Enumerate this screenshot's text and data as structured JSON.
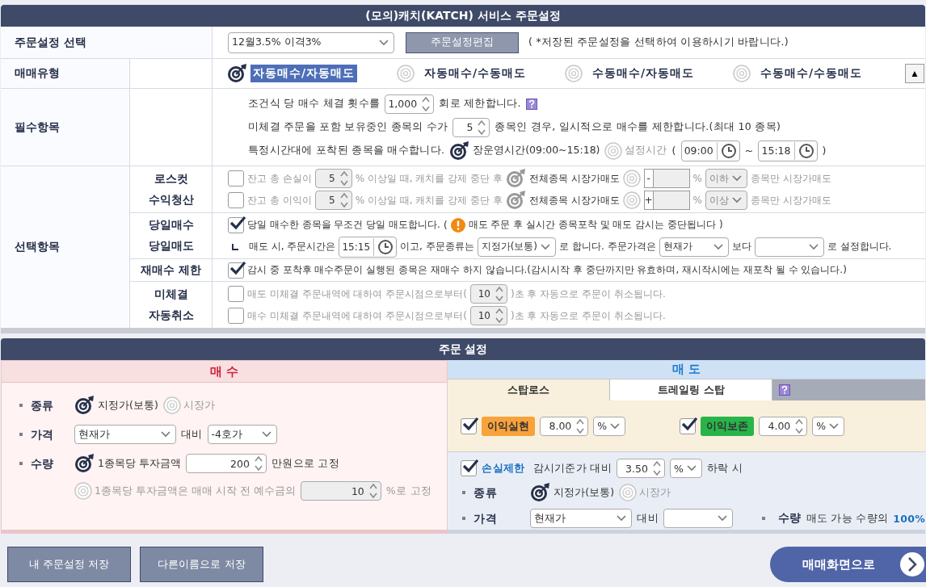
{
  "title": "(모의)캐치(KATCH) 서비스 주문설정",
  "settings_select": {
    "label": "주문설정 선택",
    "select": "12월3.5% 이격3%",
    "edit_button": "주문설정편집",
    "note": "( *저장된 주문설정을 선택하여 이용하시기 바랍니다.)"
  },
  "trade_type": {
    "label": "매매유형",
    "options": [
      {
        "label": "자동매수/자동매도",
        "selected": true
      },
      {
        "label": "자동매수/수동매도",
        "selected": false
      },
      {
        "label": "수동매수/자동매도",
        "selected": false
      },
      {
        "label": "수동매수/수동매도",
        "selected": false
      }
    ],
    "collapse_button": "▲"
  },
  "required": {
    "label": "필수항목",
    "lines": [
      {
        "items": [
          {
            "kind": "text",
            "text": "조건식 당 매수 체결 횟수를"
          },
          {
            "kind": "spin",
            "value": "1,000"
          },
          {
            "kind": "text",
            "text": "회로 제한합니다."
          },
          {
            "kind": "help"
          }
        ]
      },
      {
        "items": [
          {
            "kind": "text",
            "text": "미체결 주문을 포함 보유중인 종목의 수가"
          },
          {
            "kind": "spin",
            "value": "5"
          },
          {
            "kind": "text",
            "text": "종목인 경우, 일시적으로 매수를 제한합니다.(최대 10 종목)"
          }
        ]
      },
      {
        "items": [
          {
            "kind": "text",
            "text": "특정시간대에 포착된 종목을 매수합니다."
          },
          {
            "kind": "radio",
            "label": "장운영시간(09:00~15:18)",
            "selected": true
          },
          {
            "kind": "radio",
            "label": "설정시간",
            "selected": false
          },
          {
            "kind": "text",
            "text": "("
          },
          {
            "kind": "time",
            "value": "09:00"
          },
          {
            "kind": "text",
            "text": "~"
          },
          {
            "kind": "time",
            "value": "15:18"
          },
          {
            "kind": "text",
            "text": ")"
          }
        ]
      }
    ]
  },
  "optional": {
    "label": "선택항목",
    "groups": [
      {
        "labels": [
          "로스컷",
          "수익청산"
        ],
        "lines": [
          {
            "disabled": true,
            "items": [
              {
                "kind": "check",
                "checked": false
              },
              {
                "kind": "text",
                "text": "잔고 총 손실이"
              },
              {
                "kind": "spin",
                "value": "5"
              },
              {
                "kind": "text",
                "text": "% 이상일 때, 캐치를 강제 중단 후"
              },
              {
                "kind": "radio",
                "label": "전체종목 시장가매도",
                "selected": true
              },
              {
                "kind": "radio",
                "selected": false
              },
              {
                "kind": "signbox",
                "sign": "-"
              },
              {
                "kind": "text",
                "text": "%"
              },
              {
                "kind": "select",
                "value": "이하"
              },
              {
                "kind": "text",
                "text": "종목만 시장가매도"
              }
            ]
          },
          {
            "disabled": true,
            "items": [
              {
                "kind": "check",
                "checked": false
              },
              {
                "kind": "text",
                "text": "잔고 총 이익이"
              },
              {
                "kind": "spin",
                "value": "5"
              },
              {
                "kind": "text",
                "text": "% 이상일 때, 캐치를 강제 중단 후"
              },
              {
                "kind": "radio",
                "label": "전체종목 시장가매도",
                "selected": true
              },
              {
                "kind": "radio",
                "selected": false
              },
              {
                "kind": "signbox",
                "sign": "+"
              },
              {
                "kind": "text",
                "text": "%"
              },
              {
                "kind": "select",
                "value": "이상"
              },
              {
                "kind": "text",
                "text": "종목만 시장가매도"
              }
            ]
          }
        ]
      },
      {
        "labels": [
          "당일매수",
          "당일매도"
        ],
        "lines": [
          {
            "items": [
              {
                "kind": "check",
                "checked": true
              },
              {
                "kind": "text",
                "text": "당일 매수한 종목을 무조건 당일 매도합니다."
              },
              {
                "kind": "text",
                "text": "("
              },
              {
                "kind": "warn"
              },
              {
                "kind": "text",
                "text": "매도 주문 후 실시간 종목포착 및 매도 감시는 중단됩니다 )"
              }
            ]
          },
          {
            "items": [
              {
                "kind": "corner"
              },
              {
                "kind": "text",
                "text": "매도 시, 주문시간은"
              },
              {
                "kind": "time",
                "value": "15:15"
              },
              {
                "kind": "text",
                "text": "이고, 주문종류는"
              },
              {
                "kind": "select",
                "value": "지정가(보통)"
              },
              {
                "kind": "text",
                "text": "로 합니다."
              },
              {
                "kind": "text",
                "text": "주문가격은"
              },
              {
                "kind": "select",
                "value": "현재가"
              },
              {
                "kind": "text",
                "text": "보다"
              },
              {
                "kind": "select"
              },
              {
                "kind": "text",
                "text": "로 설정합니다."
              }
            ]
          }
        ]
      },
      {
        "labels": [
          "재매수 제한"
        ],
        "lines": [
          {
            "items": [
              {
                "kind": "check",
                "checked": true
              },
              {
                "kind": "text",
                "text": "감시 중 포착후 매수주문이 실행된 종목은 재매수 하지 않습니다.(감시시작 후 중단까지만 유효하며, 재시작시에는 재포착 될 수 있습니다.)"
              }
            ]
          }
        ]
      },
      {
        "labels": [
          "미체결",
          "자동취소"
        ],
        "lines": [
          {
            "disabled": true,
            "items": [
              {
                "kind": "check",
                "checked": false
              },
              {
                "kind": "text",
                "text": "매도 미체결 주문내역에 대하여 주문시점으로부터("
              },
              {
                "kind": "spin",
                "value": "10"
              },
              {
                "kind": "text",
                "text": ")초 후 자동으로 주문이 취소됩니다."
              }
            ]
          },
          {
            "disabled": true,
            "items": [
              {
                "kind": "check",
                "checked": false
              },
              {
                "kind": "text",
                "text": "매수 미체결 주문내역에 대하여 주문시점으로부터("
              },
              {
                "kind": "spin",
                "value": "10"
              },
              {
                "kind": "text",
                "text": ")초 후 자동으로 주문이 취소됩니다."
              }
            ]
          }
        ]
      }
    ]
  },
  "order": {
    "title": "주문 설정",
    "buy": {
      "title": "매 수",
      "rows": [
        {
          "label": "종류",
          "lines": [
            {
              "items": [
                {
                  "kind": "radio",
                  "label": "지정가(보통)",
                  "selected": true
                },
                {
                  "kind": "radio",
                  "label": "시장가",
                  "selected": false
                }
              ]
            }
          ]
        },
        {
          "label": "가격",
          "lines": [
            {
              "items": [
                {
                  "kind": "select",
                  "value": "현재가"
                },
                {
                  "kind": "text",
                  "text": "대비"
                },
                {
                  "kind": "select",
                  "value": "-4호가"
                }
              ]
            }
          ]
        },
        {
          "label": "수량",
          "lines": [
            {
              "items": [
                {
                  "kind": "radio",
                  "label": "1종목당 투자금액",
                  "selected": true
                },
                {
                  "kind": "spin",
                  "value": "200"
                },
                {
                  "kind": "text",
                  "text": "만원으로 고정"
                }
              ]
            },
            {
              "disabled": true,
              "items": [
                {
                  "kind": "radio",
                  "label": "1종목당 투자금액은 매매 시작 전 예수금의",
                  "selected": false
                },
                {
                  "kind": "spin",
                  "value": "10"
                },
                {
                  "kind": "text",
                  "text": "%로 고정"
                }
              ]
            }
          ]
        }
      ]
    },
    "sell": {
      "title": "매 도",
      "tabs": [
        {
          "label": "스탑로스",
          "selected": true
        },
        {
          "label": "트레일링 스탑",
          "selected": false
        }
      ],
      "stop_items": [
        {
          "kind": "check",
          "checked": true
        },
        {
          "kind": "badge",
          "text": "이익실현",
          "color": "#f7a23b"
        },
        {
          "kind": "spin",
          "value": "8.00"
        },
        {
          "kind": "select",
          "value": "%"
        },
        {
          "kind": "gap"
        },
        {
          "kind": "check",
          "checked": true
        },
        {
          "kind": "badge",
          "text": "이익보존",
          "color": "#27b54a"
        },
        {
          "kind": "spin",
          "value": "4.00"
        },
        {
          "kind": "select",
          "value": "%"
        }
      ],
      "loss_items": [
        {
          "kind": "check",
          "checked": true
        },
        {
          "kind": "accent",
          "text": "손실제한"
        },
        {
          "kind": "text",
          "text": "감시기준가 대비"
        },
        {
          "kind": "spin",
          "value": "3.50"
        },
        {
          "kind": "select",
          "value": "%"
        },
        {
          "kind": "text",
          "text": "하락 시"
        }
      ],
      "rows": [
        {
          "label": "종류",
          "lines": [
            {
              "items": [
                {
                  "kind": "radio",
                  "label": "지정가(보통)",
                  "selected": true
                },
                {
                  "kind": "radio",
                  "label": "시장가",
                  "selected": false
                }
              ]
            }
          ]
        },
        {
          "label": "가격",
          "lines": [
            {
              "items": [
                {
                  "kind": "select",
                  "value": "현재가"
                },
                {
                  "kind": "text",
                  "text": "대비"
                },
                {
                  "kind": "select"
                },
                {
                  "kind": "field-label",
                  "text": "수량"
                },
                {
                  "kind": "text",
                  "text": "매도 가능 수량의"
                },
                {
                  "kind": "accent",
                  "text": "100%"
                }
              ]
            }
          ]
        }
      ]
    }
  },
  "footer": {
    "buttons": [
      "내 주문설정 저장",
      "다른이름으로 저장"
    ],
    "go_button": "매매화면으로"
  }
}
